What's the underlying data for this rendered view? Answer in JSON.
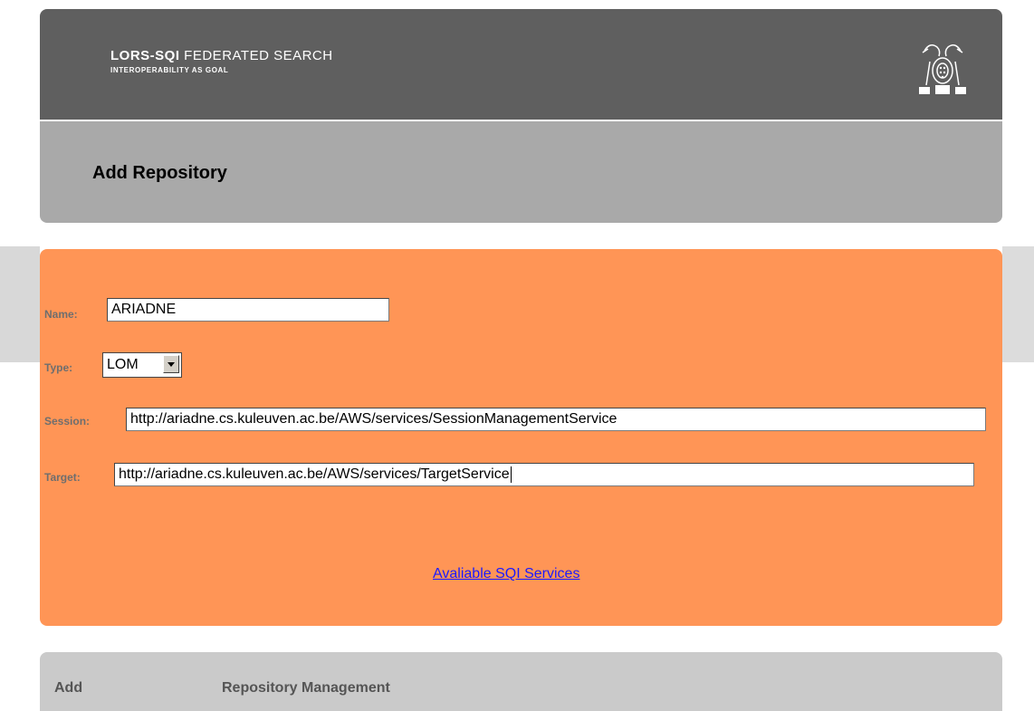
{
  "header": {
    "title_bold": "LORS-SQI",
    "title_rest": " FEDERATED SEARCH",
    "subtitle": "INTEROPERABILITY AS GOAL",
    "logo_icon": "university-crest-icon"
  },
  "page": {
    "title": "Add Repository"
  },
  "form": {
    "name": {
      "label": "Name:",
      "value": "ARIADNE"
    },
    "type": {
      "label": "Type:",
      "value": "LOM"
    },
    "session": {
      "label": "Session:",
      "value": "http://ariadne.cs.kuleuven.ac.be/AWS/services/SessionManagementService"
    },
    "target": {
      "label": "Target:",
      "value": "http://ariadne.cs.kuleuven.ac.be/AWS/services/TargetService"
    },
    "services_link": "Avaliable SQI Services"
  },
  "footer": {
    "add": "Add",
    "management": "Repository Management"
  },
  "colors": {
    "header_bg": "#5f5f5f",
    "titlebar_bg": "#a9a9a9",
    "form_bg": "#ff9556",
    "footer_bg": "#cacaca",
    "link": "#1a1aff"
  }
}
